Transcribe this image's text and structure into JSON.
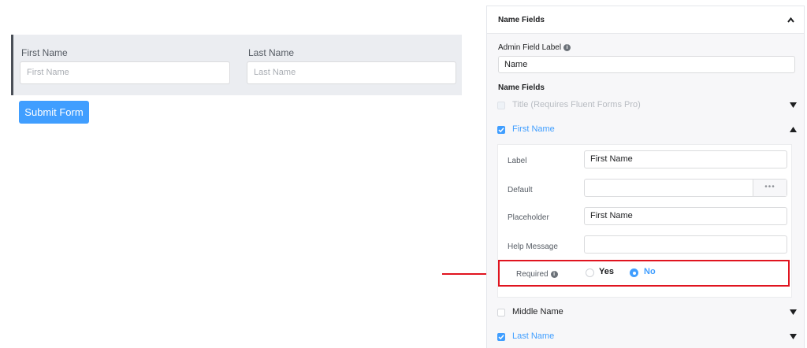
{
  "preview": {
    "fields": [
      {
        "label": "First Name",
        "placeholder": "First Name"
      },
      {
        "label": "Last Name",
        "placeholder": "Last Name"
      }
    ],
    "submit_label": "Submit Form"
  },
  "panel": {
    "title": "Name Fields",
    "admin_label": {
      "label": "Admin Field Label",
      "value": "Name"
    },
    "section_title": "Name Fields",
    "options": [
      {
        "label": "Title (Requires Fluent Forms Pro)",
        "checked": false,
        "disabled": true,
        "expanded": false
      },
      {
        "label": "First Name",
        "checked": true,
        "disabled": false,
        "expanded": true
      },
      {
        "label": "Middle Name",
        "checked": false,
        "disabled": false,
        "expanded": false
      },
      {
        "label": "Last Name",
        "checked": true,
        "disabled": false,
        "expanded": false
      }
    ],
    "first_name_settings": {
      "label": {
        "label": "Label",
        "value": "First Name"
      },
      "default": {
        "label": "Default",
        "value": "",
        "more": "•••"
      },
      "placeholder": {
        "label": "Placeholder",
        "value": "First Name"
      },
      "help_message": {
        "label": "Help Message",
        "value": ""
      },
      "required": {
        "label": "Required",
        "options": [
          "Yes",
          "No"
        ],
        "selected": "No"
      }
    }
  },
  "info_icon_glyph": "i",
  "colors": {
    "accent": "#409eff",
    "highlight": "#e0141f",
    "disabled_text": "#b8bcc2"
  }
}
